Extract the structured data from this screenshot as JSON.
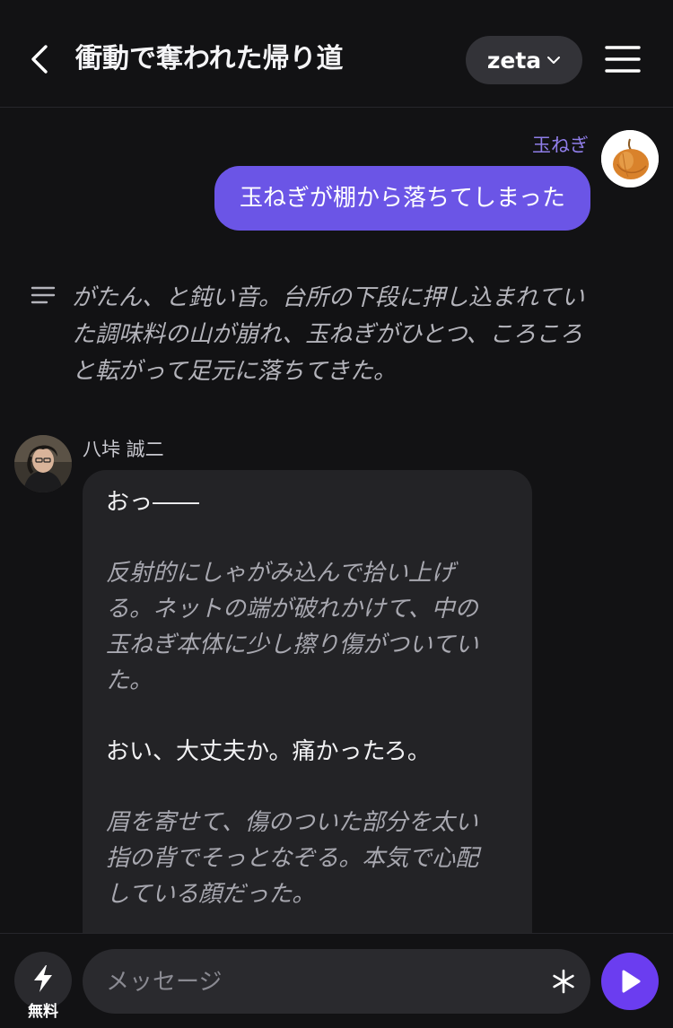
{
  "header": {
    "title": "衝動で奪われた帰り道",
    "model": "zeta",
    "back_icon": "chevron-left-icon",
    "menu_icon": "hamburger-menu-icon"
  },
  "user_message": {
    "name": "玉ねぎ",
    "text": "玉ねぎが棚から落ちてしまった",
    "avatar": "onion-avatar"
  },
  "narration": {
    "icon": "narration-lines-icon",
    "lines": [
      "がたん、と鈍い音。台所の下段に押し込まれてい",
      "た調味料の山が崩れ、玉ねぎがひとつ、ころころ",
      "と転がって足元に落ちてきた。"
    ]
  },
  "character_message": {
    "name": "八垰 誠二",
    "avatar": "character-avatar",
    "paragraphs": [
      {
        "kind": "speech",
        "lines": [
          "おっ――"
        ]
      },
      {
        "kind": "action",
        "lines": [
          "反射的にしゃがみ込んで拾い上げ",
          "る。ネットの端が破れかけて、中の",
          "玉ねぎ本体に少し擦り傷がついてい",
          "た。"
        ]
      },
      {
        "kind": "speech",
        "lines": [
          "おい、大丈夫か。痛かったろ。"
        ]
      },
      {
        "kind": "action",
        "lines": [
          "眉を寄せて、傷のついた部分を太い",
          "指の背でそっとなぞる。本気で心配",
          "している顔だった。"
        ]
      }
    ]
  },
  "composer": {
    "free_label": "無料",
    "placeholder": "メッセージ",
    "value": "",
    "free_icon": "lightning-icon",
    "asterisk_icon": "asterisk-icon",
    "send_icon": "play-send-icon"
  },
  "colors": {
    "background": "#121214",
    "accent": "#6b55e6",
    "send": "#6b3df0",
    "user_name": "#8f7de8",
    "bubble": "#232326"
  }
}
